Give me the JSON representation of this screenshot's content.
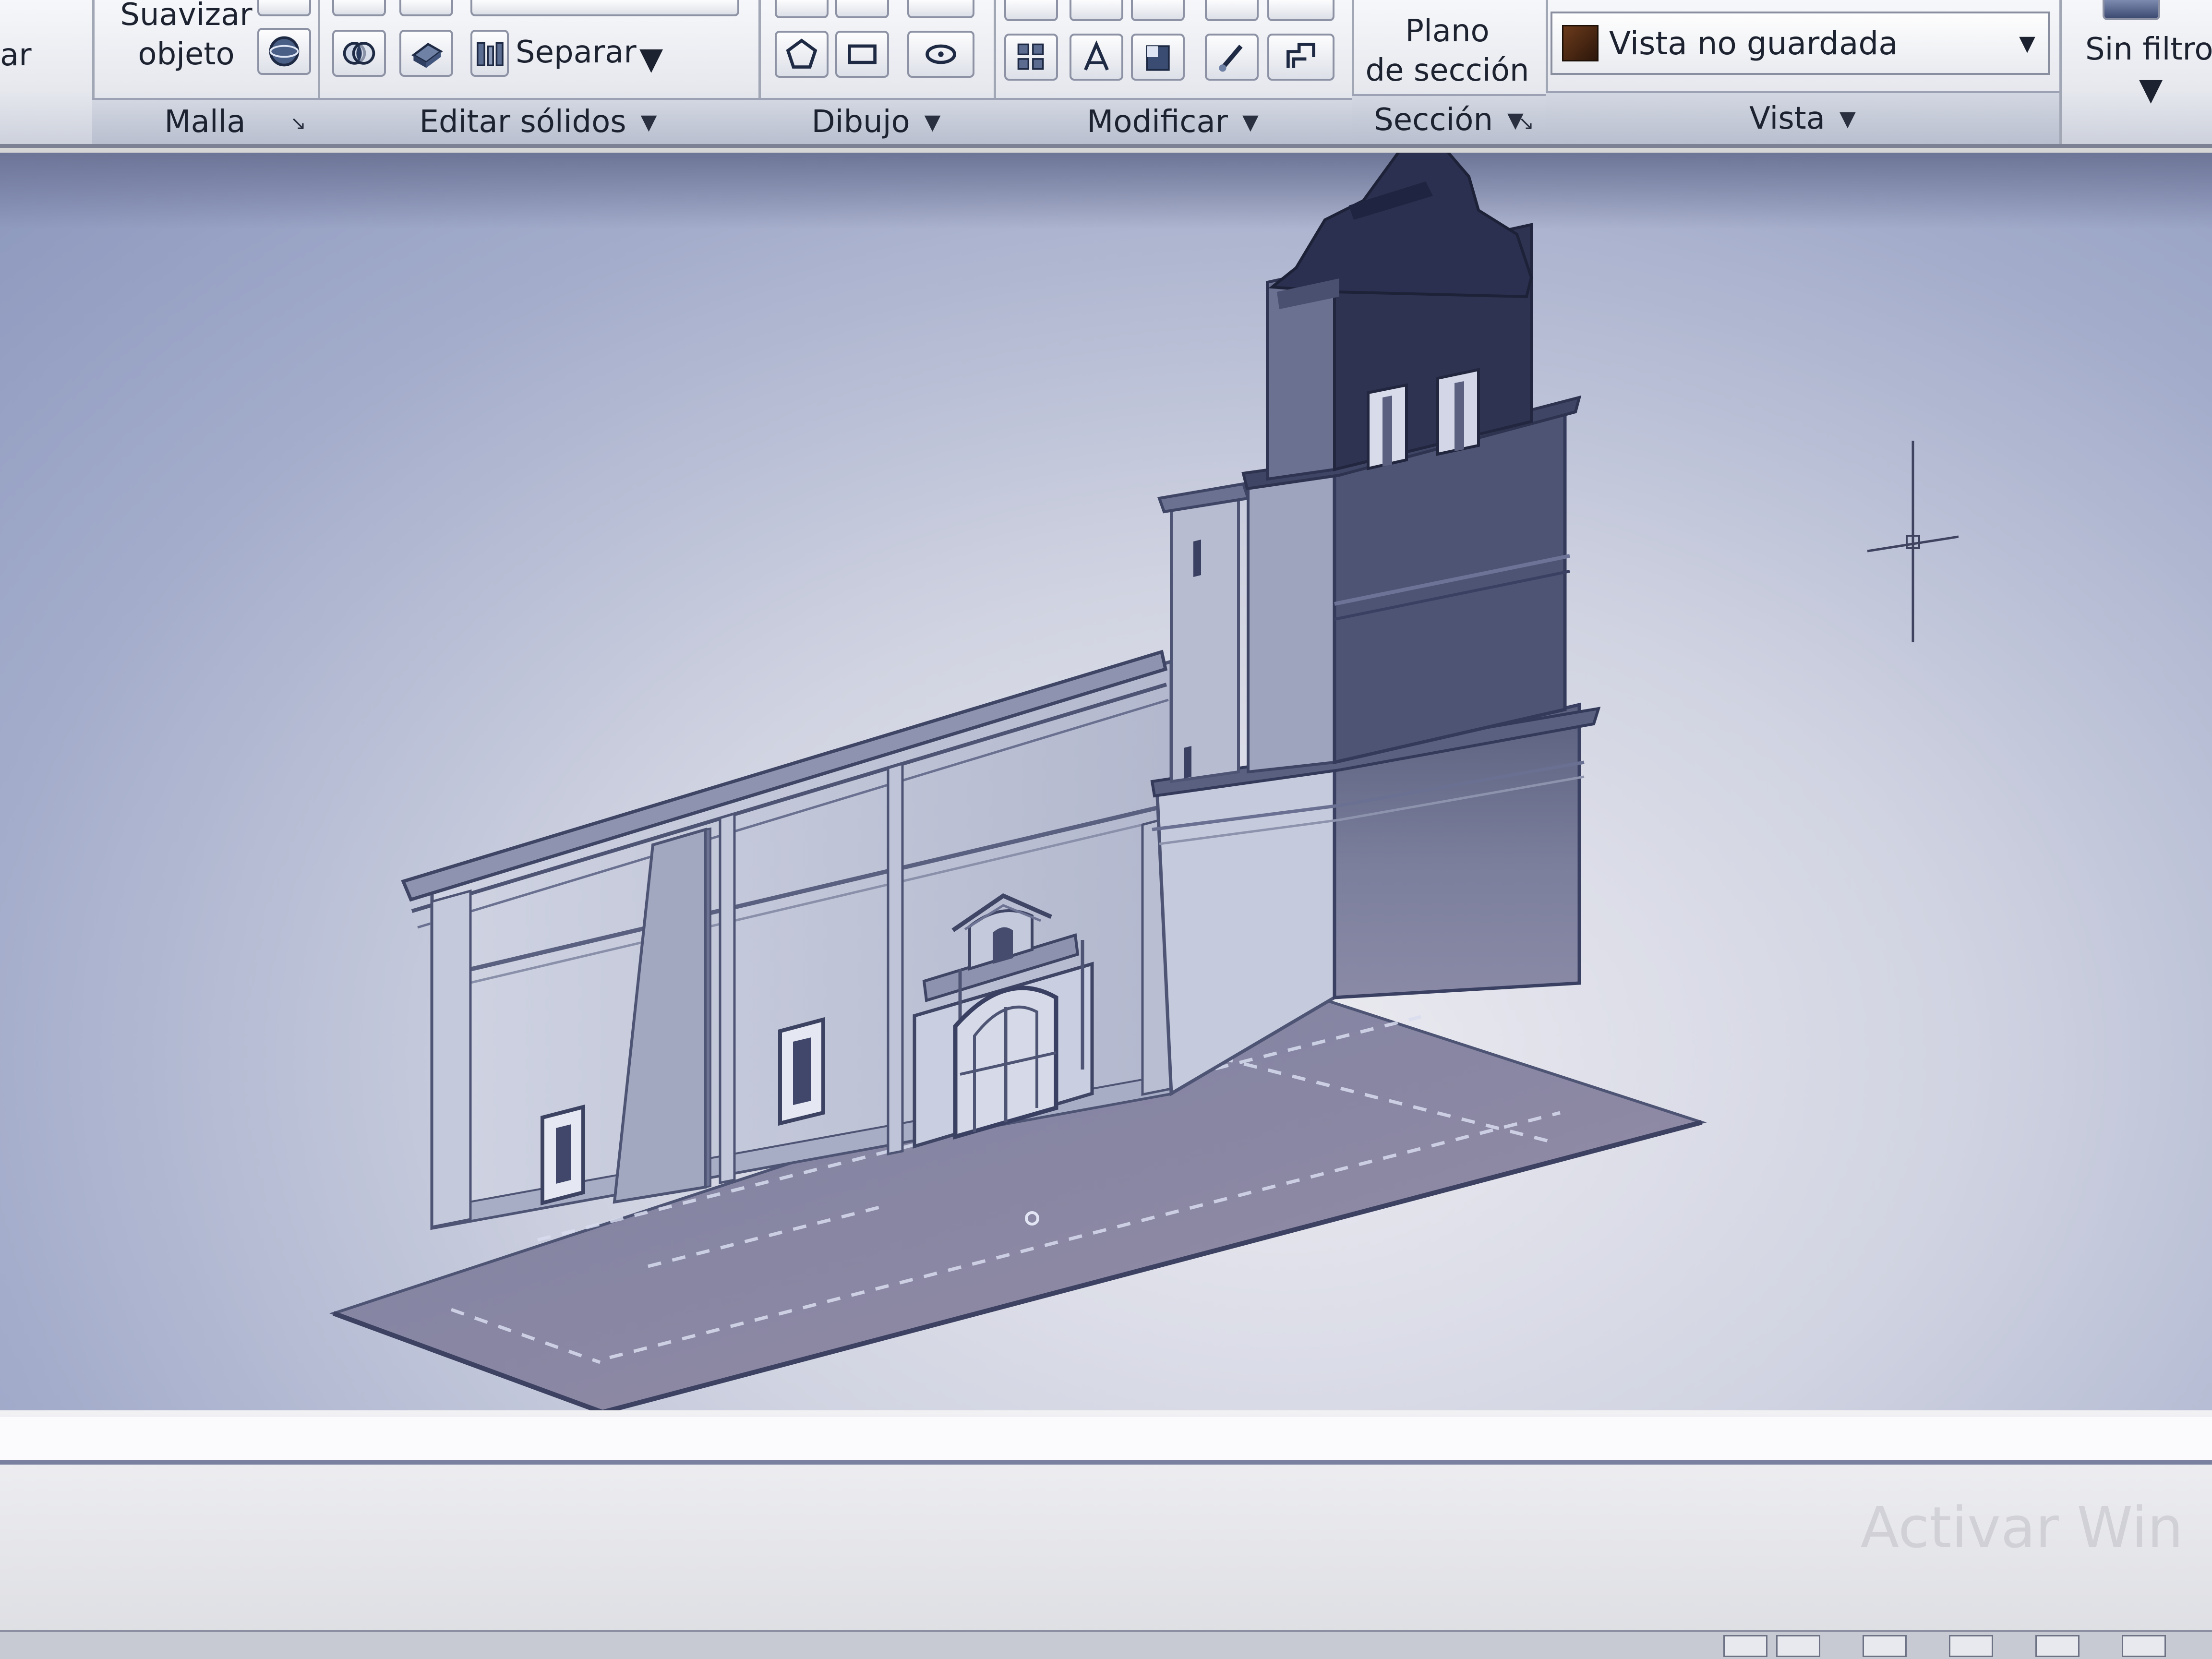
{
  "ribbon": {
    "left_fragment": "ar",
    "panels": {
      "malla": {
        "title": "Malla",
        "smooth_label_line1": "Suavizar",
        "smooth_label_line2": "objeto"
      },
      "editar": {
        "title": "Editar sólidos",
        "separar_label": "Separar"
      },
      "dibujo": {
        "title": "Dibujo"
      },
      "modificar": {
        "title": "Modificar"
      },
      "seccion": {
        "title": "Sección",
        "plano_line1": "Plano",
        "plano_line2": "de sección"
      },
      "vista": {
        "title": "Vista",
        "named_view": "Vista no guardada"
      }
    },
    "sin_filtro": "Sin filtro"
  },
  "watermark": "Activar Win"
}
